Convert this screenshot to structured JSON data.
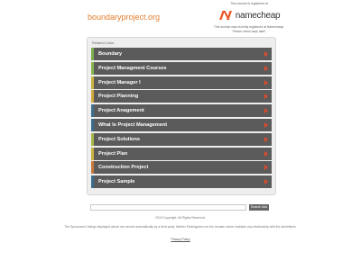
{
  "header": {
    "domain": "boundaryproject.org"
  },
  "registrar": {
    "note": "This domain is registered at",
    "brand": "namecheap",
    "description": "This domain was recently registered at Namecheap. Please check back later!"
  },
  "related_links": {
    "heading": "Related Links",
    "items": [
      {
        "label": "Boundary",
        "color": "#7dae4d"
      },
      {
        "label": "Project Managment Courses",
        "color": "#8ab64f"
      },
      {
        "label": "Project Manager I",
        "color": "#c9b240"
      },
      {
        "label": "Project Planning",
        "color": "#d0a83c"
      },
      {
        "label": "Project Anagement",
        "color": "#3d6f8f"
      },
      {
        "label": "What Is Project Management",
        "color": "#3a6d8c"
      },
      {
        "label": "Project Solutions",
        "color": "#a8b84a"
      },
      {
        "label": "Project Plan",
        "color": "#c9b240"
      },
      {
        "label": "Construction Project",
        "color": "#c8793a"
      },
      {
        "label": "Project Sample",
        "color": "#3a6d8c"
      }
    ],
    "arrow_color": "#e04a2a"
  },
  "search": {
    "placeholder": "",
    "button_label": "Search Ads"
  },
  "footer": {
    "copyright": "2016 Copyright. All Rights Reserved.",
    "disclaimer": "The Sponsored Listings displayed above are served automatically by a third party. Neither Parkingcrew nor the domain owner maintain any relationship with the advertisers.",
    "privacy_label": "Privacy Policy"
  },
  "colors": {
    "domain_text": "#e07d2e",
    "row_bg": "#5b5b5b",
    "box_bg": "#eeeeee"
  }
}
